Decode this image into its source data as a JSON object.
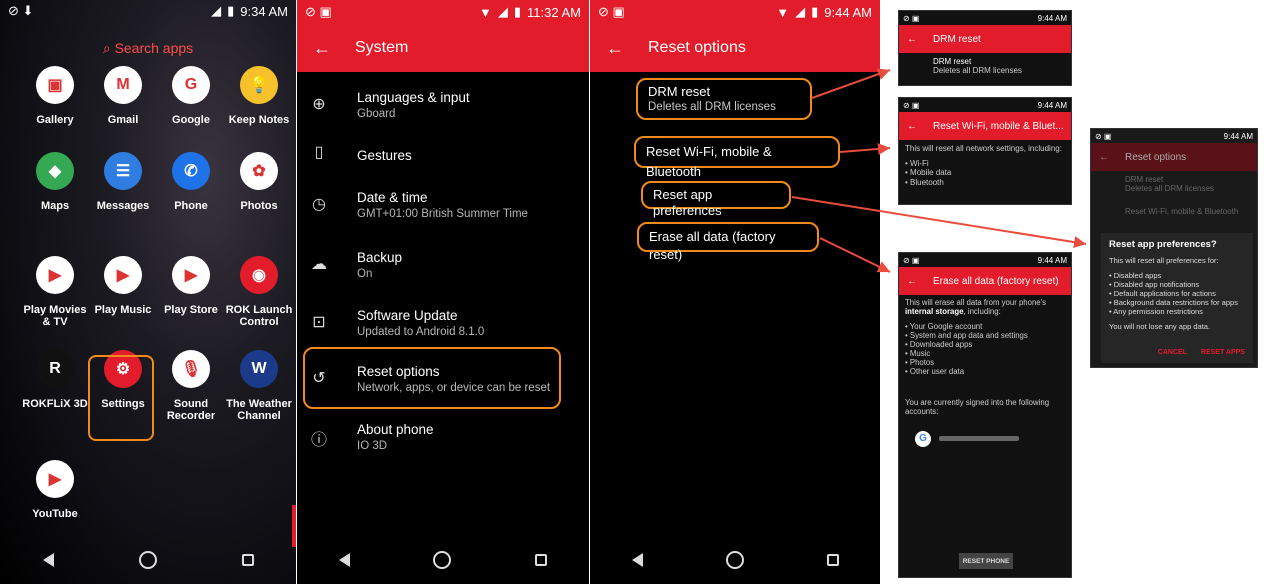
{
  "colors": {
    "accent": "#e31c2b",
    "highlight": "#f08a1c"
  },
  "launcher": {
    "time": "9:34 AM",
    "search": "Search apps",
    "apps": [
      {
        "label": "Gallery",
        "color": "#ffffff"
      },
      {
        "label": "Gmail",
        "color": "#ffffff"
      },
      {
        "label": "Google",
        "color": "#ffffff"
      },
      {
        "label": "Keep Notes",
        "color": "#f6c12b"
      },
      {
        "label": "Maps",
        "color": "#34a853"
      },
      {
        "label": "Messages",
        "color": "#2f7de1"
      },
      {
        "label": "Phone",
        "color": "#1f73e8"
      },
      {
        "label": "Photos",
        "color": "#ffffff"
      },
      {
        "label": "Play Movies & TV",
        "color": "#ffffff"
      },
      {
        "label": "Play Music",
        "color": "#ffffff"
      },
      {
        "label": "Play Store",
        "color": "#ffffff"
      },
      {
        "label": "ROK Launch Control",
        "color": "#e31c2b"
      },
      {
        "label": "ROKFLiX 3D",
        "color": "#111111"
      },
      {
        "label": "Settings",
        "color": "#e31c2b"
      },
      {
        "label": "Sound Recorder",
        "color": "#ffffff"
      },
      {
        "label": "The Weather Channel",
        "color": "#1b3a8a"
      },
      {
        "label": "YouTube",
        "color": "#ffffff"
      }
    ]
  },
  "system": {
    "time": "11:32 AM",
    "title": "System",
    "items": [
      {
        "title": "Languages & input",
        "sub": "Gboard",
        "icon": "globe-icon"
      },
      {
        "title": "Gestures",
        "sub": "",
        "icon": "gesture-phone-icon"
      },
      {
        "title": "Date & time",
        "sub": "GMT+01:00 British Summer Time",
        "icon": "clock-icon"
      },
      {
        "title": "Backup",
        "sub": "On",
        "icon": "cloud-upload-icon"
      },
      {
        "title": "Software Update",
        "sub": "Updated to Android 8.1.0",
        "icon": "system-update-icon"
      },
      {
        "title": "Reset options",
        "sub": "Network, apps, or device can be reset",
        "icon": "history-icon"
      },
      {
        "title": "About phone",
        "sub": "IO 3D",
        "icon": "info-icon"
      }
    ]
  },
  "reset": {
    "time": "9:44 AM",
    "title": "Reset options",
    "items": [
      {
        "title": "DRM reset",
        "sub": "Deletes all DRM licenses"
      },
      {
        "title": "Reset Wi-Fi, mobile & Bluetooth",
        "sub": ""
      },
      {
        "title": "Reset app preferences",
        "sub": ""
      },
      {
        "title": "Erase all data (factory reset)",
        "sub": ""
      }
    ]
  },
  "drm_mini": {
    "time": "9:44 AM",
    "title": "DRM reset",
    "item": "DRM reset",
    "sub": "Deletes all DRM licenses"
  },
  "wifi_mini": {
    "time": "9:44 AM",
    "title": "Reset Wi-Fi, mobile & Bluet...",
    "body": "This will reset all network settings, including:",
    "list": [
      "• Wi-Fi",
      "• Mobile data",
      "• Bluetooth"
    ]
  },
  "factory_mini": {
    "time": "9:44 AM",
    "title": "Erase all data (factory reset)",
    "intro": "This will erase all data from your phone's",
    "intro_bold": "internal storage",
    "intro_end": ", including:",
    "list": [
      "• Your Google account",
      "• System and app data and settings",
      "• Downloaded apps",
      "• Music",
      "• Photos",
      "• Other user data"
    ],
    "signed": "You are currently signed into the following accounts:",
    "button": "RESET PHONE"
  },
  "apps_dialog": {
    "time": "9:44 AM",
    "bg_title": "Reset options",
    "bg_item1": "DRM reset",
    "bg_item1_sub": "Deletes all DRM licenses",
    "bg_item2": "Reset Wi-Fi, mobile & Bluetooth",
    "title": "Reset app preferences?",
    "intro": "This will reset all preferences for:",
    "list": [
      "• Disabled apps",
      "• Disabled app notifications",
      "• Default applications for actions",
      "• Background data restrictions for apps",
      "• Any permission restrictions"
    ],
    "note": "You will not lose any app data.",
    "cancel": "CANCEL",
    "confirm": "RESET APPS"
  }
}
